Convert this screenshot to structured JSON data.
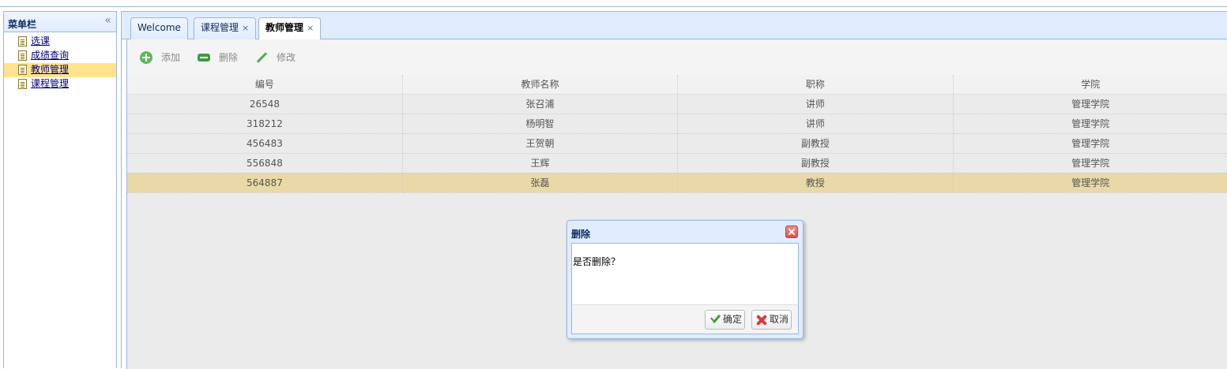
{
  "sidebar": {
    "title": "菜单栏",
    "collapse_icon": "«",
    "items": [
      {
        "label": "选课",
        "selected": false
      },
      {
        "label": "成绩查询",
        "selected": false
      },
      {
        "label": "教师管理",
        "selected": true
      },
      {
        "label": "课程管理",
        "selected": false
      }
    ]
  },
  "tabs": [
    {
      "label": "Welcome",
      "closable": false,
      "active": false
    },
    {
      "label": "课程管理",
      "closable": true,
      "active": false
    },
    {
      "label": "教师管理",
      "closable": true,
      "active": true
    }
  ],
  "tab_close_glyph": "×",
  "toolbar": {
    "add_label": "添加",
    "delete_label": "删除",
    "edit_label": "修改"
  },
  "grid": {
    "columns": [
      "编号",
      "教师名称",
      "职称",
      "学院"
    ],
    "rows": [
      [
        "26548",
        "张召浦",
        "讲师",
        "管理学院"
      ],
      [
        "318212",
        "杨明智",
        "讲师",
        "管理学院"
      ],
      [
        "456483",
        "王贺朝",
        "副教授",
        "管理学院"
      ],
      [
        "556848",
        "王辉",
        "副教授",
        "管理学院"
      ],
      [
        "564887",
        "张磊",
        "教授",
        "管理学院"
      ]
    ],
    "selected_row": 4
  },
  "dialog": {
    "title": "删除",
    "message": "是否删除？",
    "ok_label": "确定",
    "cancel_label": "取消"
  },
  "colors": {
    "border": "#95b8e7",
    "header_bg": "#e0ecff",
    "selected_row": "#e9d9a6",
    "selected_menu": "#ffe48d"
  }
}
